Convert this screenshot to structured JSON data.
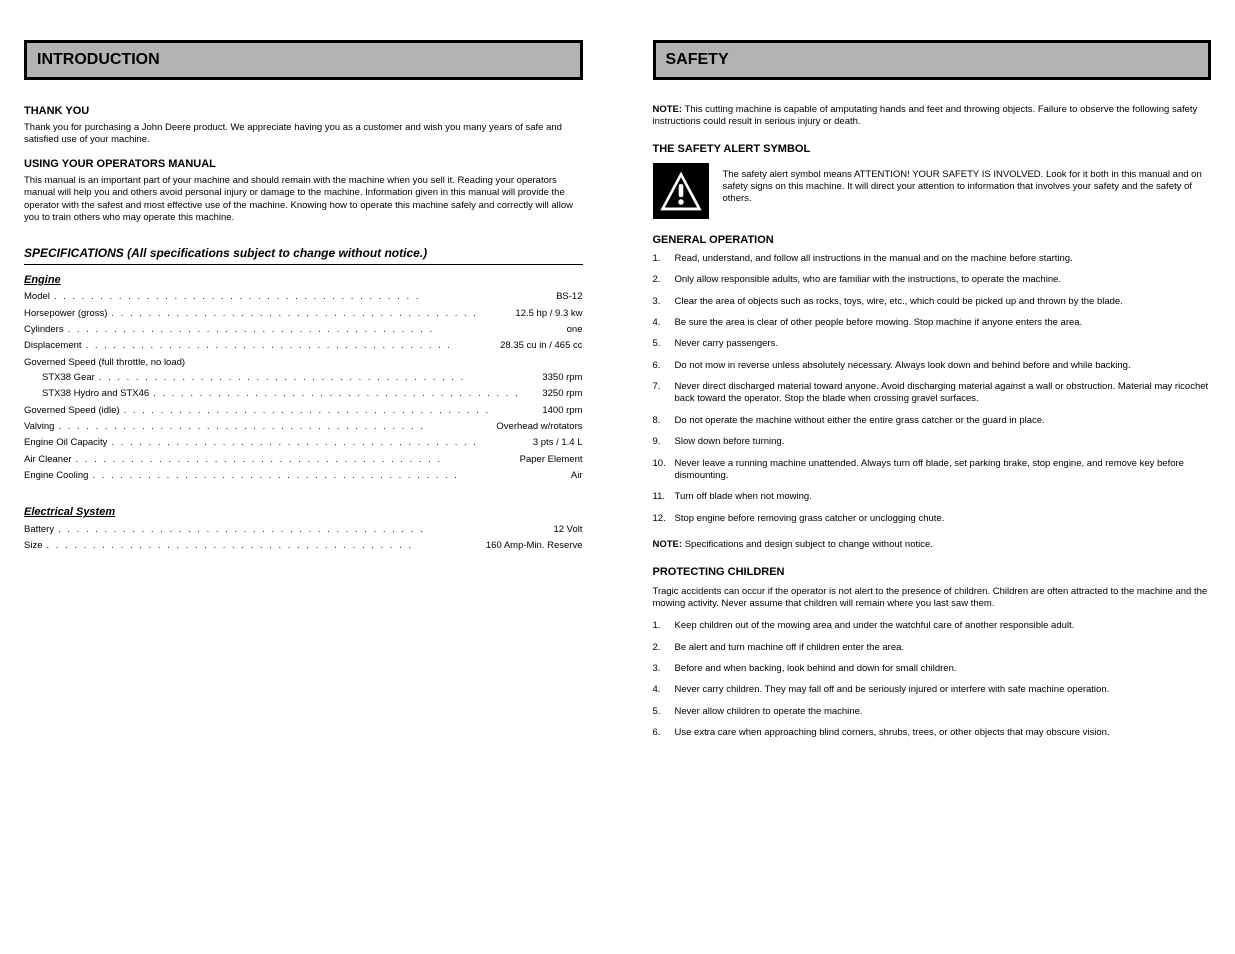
{
  "left": {
    "header": "INTRODUCTION",
    "thankyou_title": "THANK YOU",
    "thankyou_body": "Thank you for purchasing a John Deere product. We appreciate having you as a customer and wish you many years of safe and satisfied use of your machine.",
    "using_title": "USING YOUR OPERATORS MANUAL",
    "using_body": "This manual is an important part of your machine and should remain with the machine when you sell it. Reading your operators manual will help you and others avoid personal injury or damage to the machine. Information given in this manual will provide the operator with the safest and most effective use of the machine. Knowing how to operate this machine safely and correctly will allow you to train others who may operate this machine.",
    "spec_heading": "SPECIFICATIONS (All specifications subject to change without notice.)",
    "engine_heading": "Engine",
    "model": {
      "k": "Model",
      "v": "BS-12"
    },
    "engine_rows": [
      {
        "k": "Horsepower (gross)",
        "v": "12.5 hp / 9.3 kw"
      },
      {
        "k": "Cylinders",
        "v": "one"
      },
      {
        "k": "Displacement",
        "v": "28.35 cu in / 465 cc"
      },
      {
        "k": "Governed Speed (full throttle, no load)",
        "v": ""
      },
      {
        "k": "Governed Speed (idle)",
        "v": "1400 rpm"
      },
      {
        "k": "Valving",
        "v": "Overhead w/rotators"
      },
      {
        "k": "Engine Oil Capacity",
        "v": "3 pts / 1.4 L"
      },
      {
        "k": "Air Cleaner",
        "v": "Paper Element"
      },
      {
        "k": "Engine Cooling",
        "v": "Air"
      }
    ],
    "speed_sub": [
      {
        "k": "STX38 Gear",
        "v": "3350 rpm"
      },
      {
        "k": "STX38 Hydro and STX46",
        "v": "3250 rpm"
      }
    ],
    "elec_heading": "Electrical System",
    "elec_rows": [
      {
        "k": "Battery",
        "v": "12 Volt"
      },
      {
        "k": "Size",
        "v": "160 Amp-Min. Reserve"
      }
    ]
  },
  "right": {
    "header": "SAFETY",
    "note1_label": "NOTE:",
    "note1_body": "This cutting machine is capable of amputating hands and feet and throwing objects. Failure to observe the following safety instructions could result in serious injury or death.",
    "symbol_title": "THE SAFETY ALERT SYMBOL",
    "symbol_body": "The safety alert symbol means ATTENTION! YOUR SAFETY IS INVOLVED. Look for it both in this manual and on safety signs on this machine. It will direct your attention to information that involves your safety and the safety of others.",
    "general_title": "GENERAL OPERATION",
    "general_items": [
      "Read, understand, and follow all instructions in the manual and on the machine before starting.",
      "Only allow responsible adults, who are familiar with the instructions, to operate the machine.",
      "Clear the area of objects such as rocks, toys, wire, etc., which could be picked up and thrown by the blade.",
      "Be sure the area is clear of other people before mowing. Stop machine if anyone enters the area.",
      "Never carry passengers.",
      "Do not mow in reverse unless absolutely necessary. Always look down and behind before and while backing.",
      "Never direct discharged material toward anyone. Avoid discharging material against a wall or obstruction. Material may ricochet back toward the operator. Stop the blade when crossing gravel surfaces.",
      "Do not operate the machine without either the entire grass catcher or the guard in place.",
      "Slow down before turning.",
      "Never leave a running machine unattended. Always turn off blade, set parking brake, stop engine, and remove key before dismounting.",
      "Turn off blade when not mowing.",
      "Stop engine before removing grass catcher or unclogging chute."
    ],
    "note2_label": "NOTE:",
    "note2_body": "Specifications and design subject to change without notice.",
    "protect_title": "PROTECTING CHILDREN",
    "protect_intro": "Tragic accidents can occur if the operator is not alert to the presence of children. Children are often attracted to the machine and the mowing activity. Never assume that children will remain where you last saw them.",
    "protect_items": [
      "Keep children out of the mowing area and under the watchful care of another responsible adult.",
      "Be alert and turn machine off if children enter the area.",
      "Before and when backing, look behind and down for small children.",
      "Never carry children. They may fall off and be seriously injured or interfere with safe machine operation.",
      "Never allow children to operate the machine.",
      "Use extra care when approaching blind corners, shrubs, trees, or other objects that may obscure vision."
    ]
  }
}
